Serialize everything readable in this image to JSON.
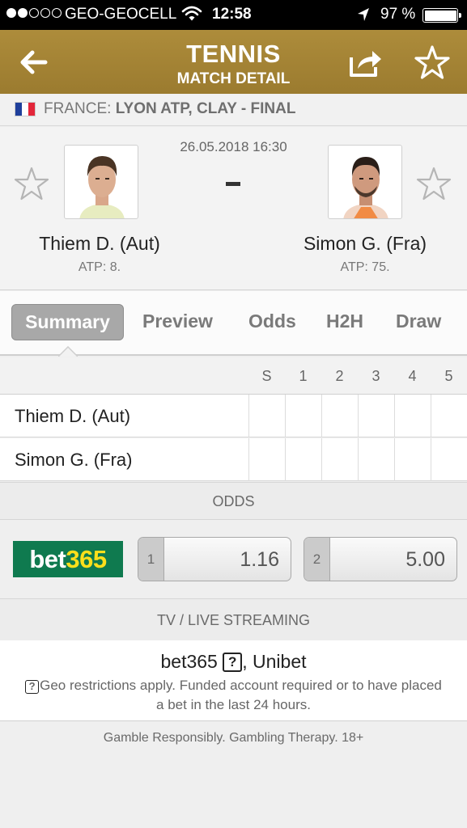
{
  "status_bar": {
    "carrier": "GEO-GEOCELL",
    "time": "12:58",
    "battery": "97 %",
    "signal_bars_filled": 2,
    "signal_bars_total": 5
  },
  "header": {
    "title": "TENNIS",
    "subtitle": "MATCH DETAIL",
    "back_icon": "back-arrow-icon",
    "share_icon": "share-icon",
    "favorite_icon": "star-icon"
  },
  "tournament": {
    "country": "FRANCE:",
    "name": "LYON ATP, CLAY - FINAL",
    "flag_colors": [
      "#1f3f9b",
      "#ffffff",
      "#e3263a"
    ]
  },
  "match": {
    "datetime": "26.05.2018 16:30",
    "score_separator": "-",
    "home": {
      "name": "Thiem D. (Aut)",
      "rank": "ATP: 8."
    },
    "away": {
      "name": "Simon G. (Fra)",
      "rank": "ATP: 75."
    }
  },
  "tabs": [
    {
      "label": "Summary",
      "active": true
    },
    {
      "label": "Preview",
      "active": false
    },
    {
      "label": "Odds",
      "active": false
    },
    {
      "label": "H2H",
      "active": false
    },
    {
      "label": "Draw",
      "active": false
    }
  ],
  "score_table": {
    "columns": [
      "S",
      "1",
      "2",
      "3",
      "4",
      "5"
    ],
    "rows": [
      {
        "player": "Thiem D. (Aut)",
        "scores": [
          "",
          "",
          "",
          "",
          "",
          ""
        ]
      },
      {
        "player": "Simon G. (Fra)",
        "scores": [
          "",
          "",
          "",
          "",
          "",
          ""
        ]
      }
    ]
  },
  "odds": {
    "section_title": "ODDS",
    "bookmaker": {
      "part1": "bet",
      "part2": "365"
    },
    "options": [
      {
        "label": "1",
        "value": "1.16"
      },
      {
        "label": "2",
        "value": "5.00"
      }
    ]
  },
  "streaming": {
    "section_title": "TV / LIVE STREAMING",
    "provider_1": "bet365",
    "help_mark": "?",
    "provider_2": ", Unibet",
    "note": "Geo restrictions apply. Funded account required or to have placed a bet in the last 24 hours."
  },
  "footer": {
    "gamble_text": "Gamble Responsibly. Gambling Therapy. 18+"
  },
  "colors": {
    "header_gold": "#a3832f",
    "bet365_green": "#0f7a4f",
    "bet365_yellow": "#ffdf1b",
    "tab_active_bg": "#a8a8a8"
  }
}
